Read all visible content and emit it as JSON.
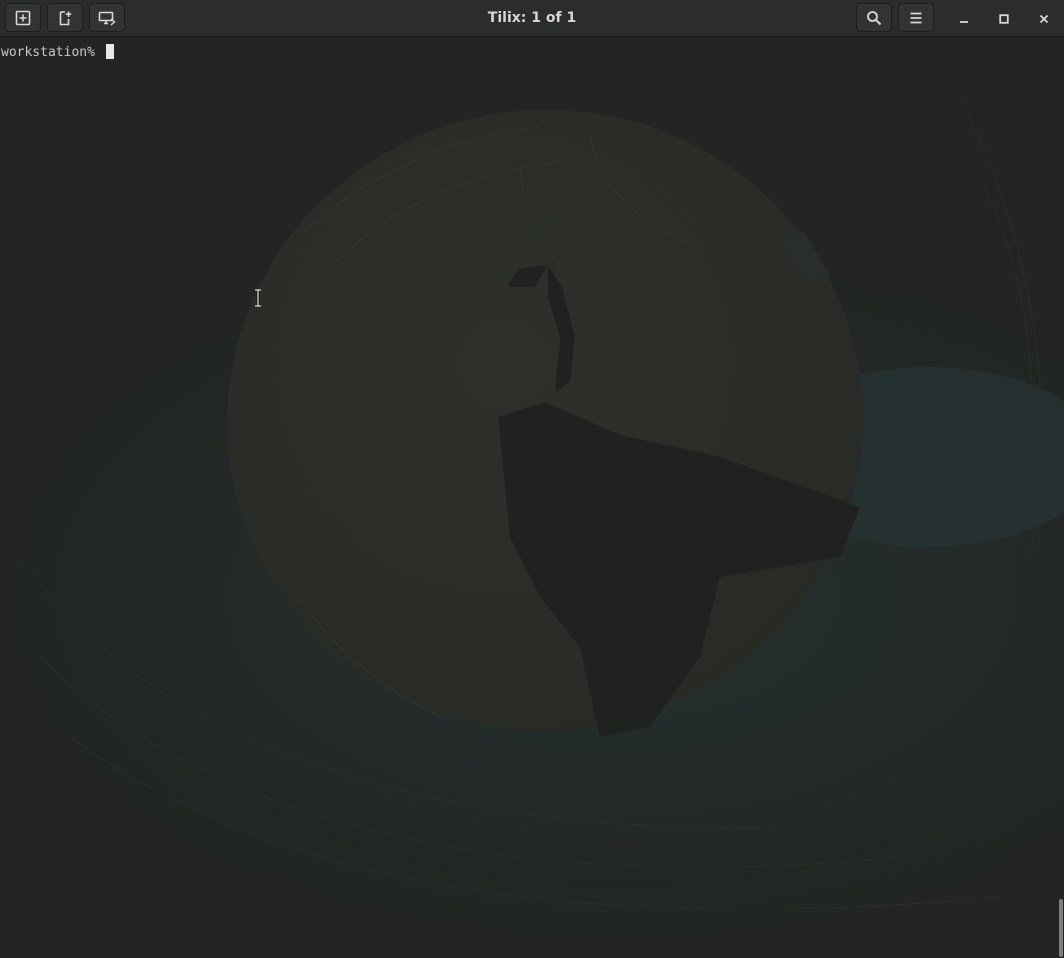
{
  "window": {
    "title": "Tilix: 1 of 1"
  },
  "headerbar": {
    "left_buttons": [
      {
        "icon": "add-terminal-icon"
      },
      {
        "icon": "add-session-icon"
      },
      {
        "icon": "sync-input-icon"
      }
    ],
    "right_buttons": [
      {
        "icon": "search-icon"
      },
      {
        "icon": "hamburger-menu-icon"
      }
    ],
    "window_controls": [
      {
        "icon": "minimize-icon"
      },
      {
        "icon": "maximize-icon"
      },
      {
        "icon": "close-icon"
      }
    ]
  },
  "terminal": {
    "prompt": "workstation% "
  },
  "colors": {
    "headerbar_bg": "#2b2d2b",
    "terminal_bg": "#222522",
    "title_text": "#d6d6d3",
    "terminal_text": "#c8c8c4",
    "cursor": "#e8e8e4"
  }
}
